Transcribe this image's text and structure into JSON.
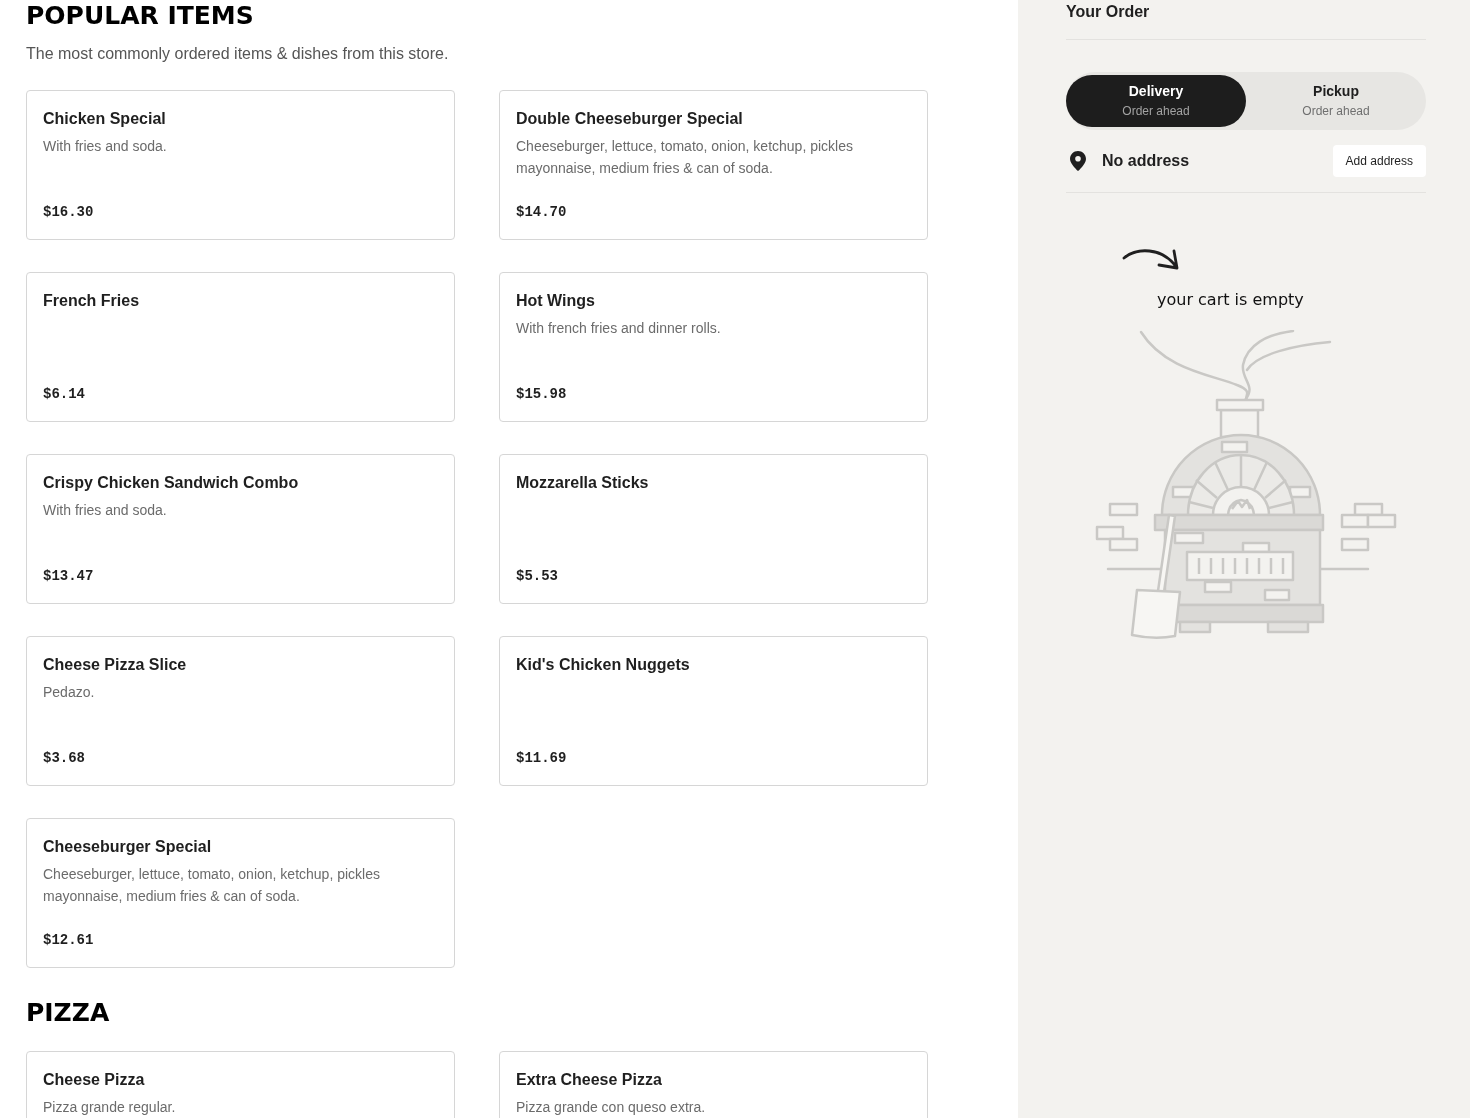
{
  "sections": [
    {
      "title": "POPULAR ITEMS",
      "subtitle": "The most commonly ordered items & dishes from this store.",
      "items": [
        {
          "name": "Chicken Special",
          "description": "With fries and soda.",
          "price": "$16.30"
        },
        {
          "name": "Double Cheeseburger Special",
          "description": "Cheeseburger, lettuce, tomato, onion, ketchup, pickles mayonnaise, medium fries & can of soda.",
          "price": "$14.70"
        },
        {
          "name": "French Fries",
          "price": "$6.14"
        },
        {
          "name": "Hot Wings",
          "description": "With french fries and dinner rolls.",
          "price": "$15.98"
        },
        {
          "name": "Crispy Chicken Sandwich Combo",
          "description": "With fries and soda.",
          "price": "$13.47"
        },
        {
          "name": "Mozzarella Sticks",
          "price": "$5.53"
        },
        {
          "name": "Cheese Pizza Slice",
          "description": "Pedazo.",
          "price": "$3.68"
        },
        {
          "name": "Kid's Chicken Nuggets",
          "price": "$11.69"
        },
        {
          "name": "Cheeseburger Special",
          "description": "Cheeseburger, lettuce, tomato, onion, ketchup, pickles mayonnaise, medium fries & can of soda.",
          "price": "$12.61"
        }
      ]
    },
    {
      "title": "PIZZA",
      "items": [
        {
          "name": "Cheese Pizza",
          "description": "Pizza grande regular."
        },
        {
          "name": "Extra Cheese Pizza",
          "description": "Pizza grande con queso extra."
        }
      ]
    }
  ],
  "order": {
    "title": "Your Order",
    "modes": [
      {
        "label": "Delivery",
        "sublabel": "Order ahead",
        "selected": true
      },
      {
        "label": "Pickup",
        "sublabel": "Order ahead",
        "selected": false
      }
    ],
    "address": {
      "text": "No address",
      "button": "Add address"
    },
    "empty_cart": {
      "message": "your cart is empty"
    }
  }
}
